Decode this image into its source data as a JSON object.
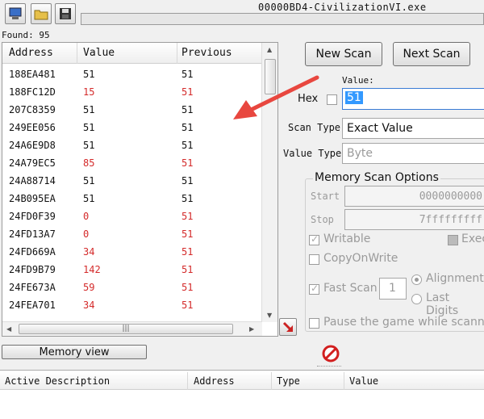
{
  "window": {
    "title": "00000BD4-CivilizationVI.exe"
  },
  "toolbar": {
    "open_process": "computer-icon",
    "open_file": "folder-icon",
    "save": "floppy-icon"
  },
  "found": "Found: 95",
  "columns": {
    "address": "Address",
    "value": "Value",
    "previous": "Previous"
  },
  "rows": [
    {
      "address": "188EA481",
      "value": "51",
      "previous": "51",
      "changed": false
    },
    {
      "address": "188FC12D",
      "value": "15",
      "previous": "51",
      "changed": true
    },
    {
      "address": "207C8359",
      "value": "51",
      "previous": "51",
      "changed": false
    },
    {
      "address": "249EE056",
      "value": "51",
      "previous": "51",
      "changed": false
    },
    {
      "address": "24A6E9D8",
      "value": "51",
      "previous": "51",
      "changed": false
    },
    {
      "address": "24A79EC5",
      "value": "85",
      "previous": "51",
      "changed": true
    },
    {
      "address": "24A88714",
      "value": "51",
      "previous": "51",
      "changed": false
    },
    {
      "address": "24B095EA",
      "value": "51",
      "previous": "51",
      "changed": false
    },
    {
      "address": "24FD0F39",
      "value": "0",
      "previous": "51",
      "changed": true
    },
    {
      "address": "24FD13A7",
      "value": "0",
      "previous": "51",
      "changed": true
    },
    {
      "address": "24FD669A",
      "value": "34",
      "previous": "51",
      "changed": true
    },
    {
      "address": "24FD9B79",
      "value": "142",
      "previous": "51",
      "changed": true
    },
    {
      "address": "24FE673A",
      "value": "59",
      "previous": "51",
      "changed": true
    },
    {
      "address": "24FEA701",
      "value": "34",
      "previous": "51",
      "changed": true
    }
  ],
  "buttons": {
    "new_scan": "New Scan",
    "next_scan": "Next Scan",
    "memory_view": "Memory view"
  },
  "scan": {
    "value_label": "Value:",
    "hex_label": "Hex",
    "value": "51",
    "scan_type_label": "Scan Type",
    "scan_type": "Exact Value",
    "value_type_label": "Value Type",
    "value_type": "Byte"
  },
  "options": {
    "title": "Memory Scan Options",
    "start_label": "Start",
    "start_value": "0000000000",
    "stop_label": "Stop",
    "stop_value": "7fffffffff",
    "writable": "Writable",
    "executable": "Exec",
    "copy_on_write": "CopyOnWrite",
    "fast_scan": "Fast Scan",
    "fast_scan_value": "1",
    "alignment": "Alignment",
    "last_digits": "Last Digits",
    "pause": "Pause the game while scanning"
  },
  "address_list": {
    "active": "Active Description",
    "address": "Address",
    "type": "Type",
    "value": "Value"
  },
  "colors": {
    "changed": "#d42a2a",
    "arrow": "#e8473f",
    "selection": "#3399ff",
    "stop_icon": "#d21f1f"
  },
  "icons": {
    "annotation": "red-arrow",
    "add_to_list": "red-arrow-down-right-icon",
    "stop": "stop-icon"
  }
}
